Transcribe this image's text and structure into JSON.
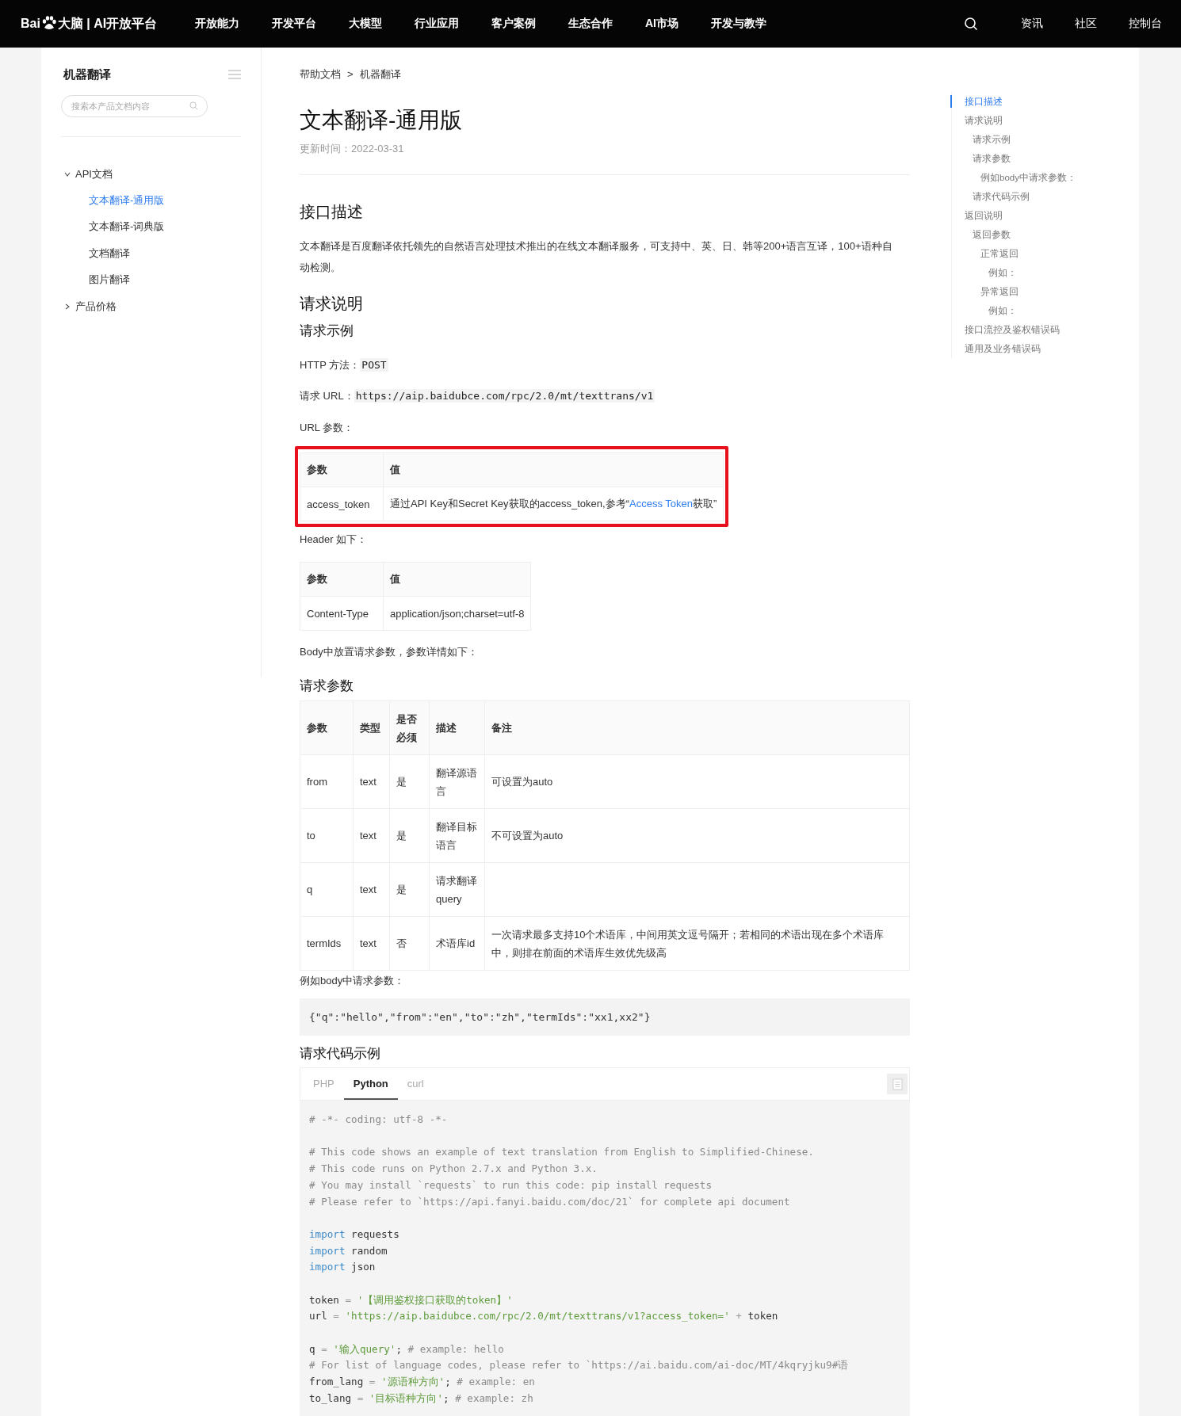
{
  "top_nav": {
    "logo": {
      "text_before": "Bai",
      "text_after": "大脑 | AI开放平台"
    },
    "items": [
      {
        "label": "开放能力"
      },
      {
        "label": "开发平台"
      },
      {
        "label": "大模型"
      },
      {
        "label": "行业应用"
      },
      {
        "label": "客户案例"
      },
      {
        "label": "生态合作"
      },
      {
        "label": "AI市场"
      },
      {
        "label": "开发与教学"
      }
    ],
    "right_links": [
      {
        "label": "资讯"
      },
      {
        "label": "社区"
      },
      {
        "label": "控制台"
      }
    ]
  },
  "sidebar": {
    "title": "机器翻译",
    "search": {
      "placeholder": "搜索本产品文档内容"
    },
    "tree": [
      {
        "label": "API文档",
        "expanded": true,
        "selected": false,
        "children": [
          {
            "label": "文本翻译-通用版",
            "selected": true
          },
          {
            "label": "文本翻译-词典版",
            "selected": false
          },
          {
            "label": "文档翻译",
            "selected": false
          },
          {
            "label": "图片翻译",
            "selected": false
          }
        ]
      },
      {
        "label": "产品价格",
        "expanded": false,
        "selected": false
      }
    ]
  },
  "breadcrumb": [
    "帮助文档",
    "机器翻译"
  ],
  "breadcrumb_separator": ">",
  "title": "文本翻译-通用版",
  "updated": "更新时间：2022-03-31",
  "sections": {
    "intro_heading": "接口描述",
    "intro_text": "文本翻译是百度翻译依托领先的自然语言处理技术推出的在线文本翻译服务，可支持中、英、日、韩等200+语言互译，100+语种自动检测。",
    "request_heading": "请求说明",
    "example_heading": "请求示例",
    "http_method": {
      "label": "HTTP 方法：",
      "code": "POST"
    },
    "request_url": {
      "label": "请求 URL：",
      "code": "https://aip.baidubce.com/rpc/2.0/mt/texttrans/v1"
    },
    "url_params_label": "URL 参数：",
    "url_params_table": {
      "highlighted": true,
      "columns": [
        "参数",
        "值"
      ],
      "rows": [
        {
          "param": "access_token",
          "value": {
            "text_before": "通过API Key和Secret Key获取的access_token,参考“",
            "link": "Access Token",
            "text_after": "获取”"
          }
        }
      ]
    },
    "header_label": "Header 如下：",
    "header_table": {
      "columns": [
        "参数",
        "值"
      ],
      "rows": [
        [
          "Content-Type",
          "application/json;charset=utf-8"
        ]
      ]
    },
    "body_label": "Body中放置请求参数，参数详情如下：",
    "params_heading": "请求参数",
    "params_table": {
      "columns": [
        "参数",
        "类型",
        "是否必须",
        "描述",
        "备注"
      ],
      "rows": [
        [
          "from",
          "text",
          "是",
          "翻译源语言",
          "可设置为auto"
        ],
        [
          "to",
          "text",
          "是",
          "翻译目标语言",
          "不可设置为auto"
        ],
        [
          "q",
          "text",
          "是",
          "请求翻译query",
          ""
        ],
        [
          "termIds",
          "text",
          "否",
          "术语库id",
          "一次请求最多支持10个术语库，中间用英文逗号隔开；若相同的术语出现在多个术语库中，则排在前面的术语库生效优先级高"
        ]
      ]
    },
    "body_example_label": "例如body中请求参数：",
    "body_example_code": "{\"q\":\"hello\",\"from\":\"en\",\"to\":\"zh\",\"termIds\":\"xx1,xx2\"}",
    "code_heading": "请求代码示例"
  },
  "code_tabs": [
    {
      "label": "PHP",
      "selected": false
    },
    {
      "label": "Python",
      "selected": true
    },
    {
      "label": "curl",
      "selected": false
    }
  ],
  "code_lines": [
    {
      "kind": "code",
      "segments": [
        {
          "kind": "comment",
          "text": "# -*- coding: utf-8 -*-"
        }
      ]
    },
    {
      "kind": "blank"
    },
    {
      "kind": "code",
      "segments": [
        {
          "kind": "comment",
          "text": "# This code shows an example of text translation from English to Simplified-Chinese."
        }
      ]
    },
    {
      "kind": "code",
      "segments": [
        {
          "kind": "comment",
          "text": "# This code runs on Python 2.7.x and Python 3.x."
        }
      ]
    },
    {
      "kind": "code",
      "segments": [
        {
          "kind": "comment",
          "text": "# You may install `requests` to run this code: pip install requests"
        }
      ]
    },
    {
      "kind": "code",
      "segments": [
        {
          "kind": "comment",
          "text": "# Please refer to `https://api.fanyi.baidu.com/doc/21` for complete api document"
        }
      ]
    },
    {
      "kind": "blank"
    },
    {
      "kind": "code",
      "segments": [
        {
          "kind": "keyword",
          "text": "import"
        },
        {
          "kind": "plain",
          "text": " requests"
        }
      ]
    },
    {
      "kind": "code",
      "segments": [
        {
          "kind": "keyword",
          "text": "import"
        },
        {
          "kind": "plain",
          "text": " random"
        }
      ]
    },
    {
      "kind": "code",
      "segments": [
        {
          "kind": "keyword",
          "text": "import"
        },
        {
          "kind": "plain",
          "text": " json"
        }
      ]
    },
    {
      "kind": "blank"
    },
    {
      "kind": "code",
      "segments": [
        {
          "kind": "plain",
          "text": "token "
        },
        {
          "kind": "operator",
          "text": "= "
        },
        {
          "kind": "string",
          "text": "'【调用鉴权接口获取的token】'"
        }
      ]
    },
    {
      "kind": "code",
      "segments": [
        {
          "kind": "plain",
          "text": "url "
        },
        {
          "kind": "operator",
          "text": "= "
        },
        {
          "kind": "string",
          "text": "'https://aip.baidubce.com/rpc/2.0/mt/texttrans/v1?access_token='"
        },
        {
          "kind": "operator",
          "text": " +"
        },
        {
          "kind": "plain",
          "text": " token"
        }
      ]
    },
    {
      "kind": "blank"
    },
    {
      "kind": "code",
      "segments": [
        {
          "kind": "plain",
          "text": "q "
        },
        {
          "kind": "operator",
          "text": "= "
        },
        {
          "kind": "string",
          "text": "'输入query'"
        },
        {
          "kind": "plain",
          "text": "; "
        },
        {
          "kind": "comment",
          "text": "# example: hello"
        }
      ]
    },
    {
      "kind": "code",
      "segments": [
        {
          "kind": "comment",
          "text": "# For list of language codes, please refer to `https://ai.baidu.com/ai-doc/MT/4kqryjku9#语"
        }
      ]
    },
    {
      "kind": "code",
      "segments": [
        {
          "kind": "plain",
          "text": "from_lang "
        },
        {
          "kind": "operator",
          "text": "= "
        },
        {
          "kind": "string",
          "text": "'源语种方向'"
        },
        {
          "kind": "plain",
          "text": "; "
        },
        {
          "kind": "comment",
          "text": "# example: en"
        }
      ]
    },
    {
      "kind": "code",
      "segments": [
        {
          "kind": "plain",
          "text": "to_lang "
        },
        {
          "kind": "operator",
          "text": "= "
        },
        {
          "kind": "string",
          "text": "'目标语种方向'"
        },
        {
          "kind": "plain",
          "text": "; "
        },
        {
          "kind": "comment",
          "text": "# example: zh"
        }
      ]
    }
  ],
  "toc": {
    "items": [
      {
        "label": "接口描述",
        "selected": true
      },
      {
        "label": "请求说明",
        "selected": false,
        "children": [
          {
            "label": "请求示例",
            "selected": false
          },
          {
            "label": "请求参数",
            "selected": false,
            "children": [
              {
                "label": "例如body中请求参数：",
                "selected": false
              }
            ]
          },
          {
            "label": "请求代码示例",
            "selected": false
          }
        ]
      },
      {
        "label": "返回说明",
        "selected": false,
        "children": [
          {
            "label": "返回参数",
            "selected": false,
            "children": [
              {
                "label": "正常返回",
                "selected": false,
                "children": [
                  {
                    "label": "例如：",
                    "selected": false
                  }
                ]
              },
              {
                "label": "异常返回",
                "selected": false,
                "children": [
                  {
                    "label": "例如：",
                    "selected": false
                  }
                ]
              }
            ]
          }
        ]
      },
      {
        "label": "接口流控及鉴权错误码",
        "selected": false
      },
      {
        "label": "通用及业务错误码",
        "selected": false
      }
    ]
  }
}
